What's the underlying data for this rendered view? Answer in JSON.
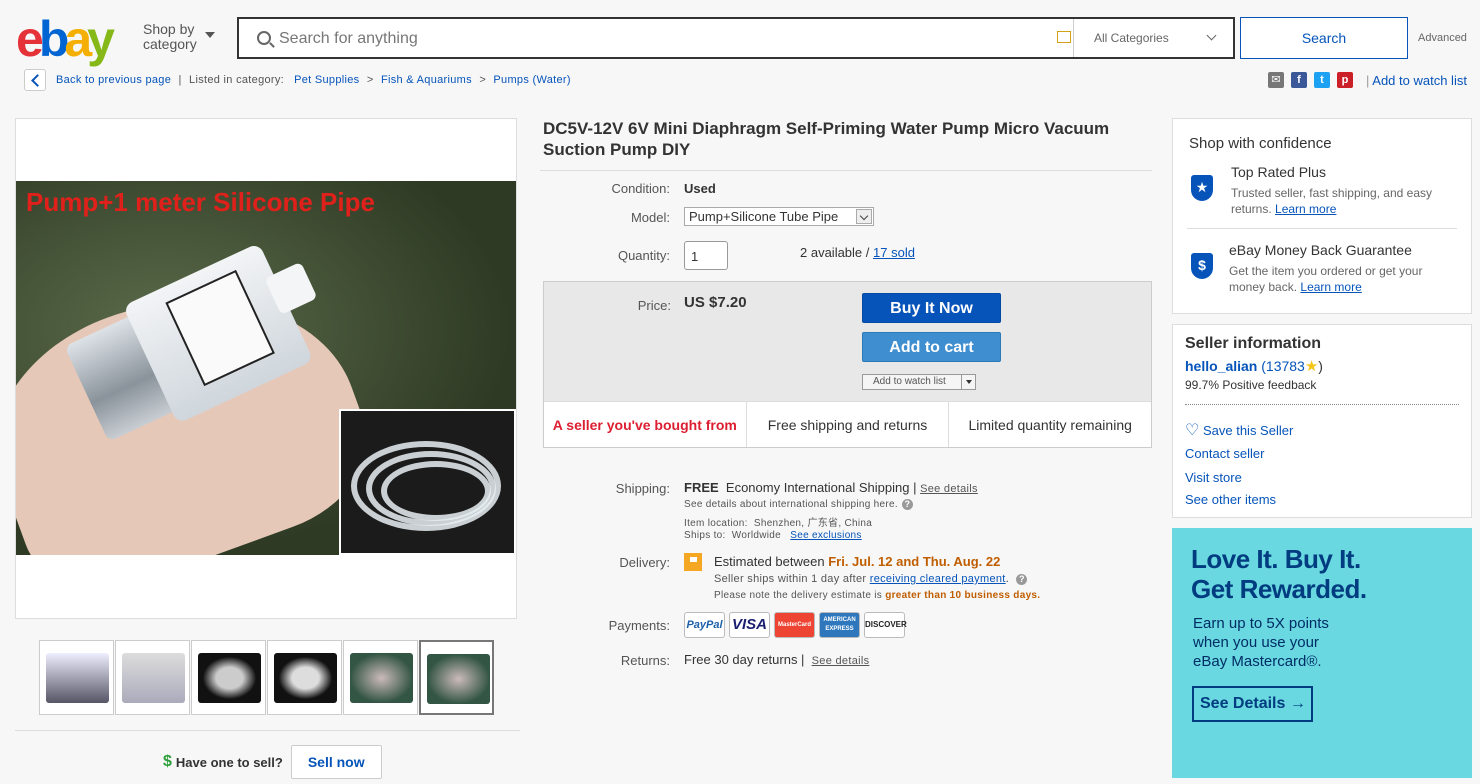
{
  "header": {
    "logo_letters": [
      "e",
      "b",
      "a",
      "y"
    ],
    "logo_colors": [
      "#e53238",
      "#0064d2",
      "#f5af02",
      "#86b817"
    ],
    "shop_by": "Shop by",
    "category": "category",
    "search_placeholder": "Search for anything",
    "category_select": "All Categories",
    "search_button": "Search",
    "advanced": "Advanced"
  },
  "breadcrumb": {
    "back": "Back to previous page",
    "listed_in": "Listed in category:",
    "items": [
      "Pet Supplies",
      "Fish & Aquariums",
      "Pumps (Water)"
    ],
    "add_to_watch": "Add to watch list"
  },
  "gallery": {
    "caption": "Pump+1 meter Silicone Pipe",
    "thumb_count": 6
  },
  "sell": {
    "have_one": "Have one to sell?",
    "sell_now": "Sell now"
  },
  "item": {
    "title": "DC5V-12V 6V Mini Diaphragm Self-Priming Water Pump Micro Vacuum Suction Pump DIY",
    "condition_label": "Condition:",
    "condition": "Used",
    "model_label": "Model:",
    "model": "Pump+Silicone Tube Pipe",
    "quantity_label": "Quantity:",
    "quantity": "1",
    "available": "2 available /",
    "sold": "17 sold",
    "price_label": "Price:",
    "price": "US $7.20",
    "buy_now": "Buy It Now",
    "add_to_cart": "Add to cart",
    "add_to_watch_small": "Add to watch list",
    "highlights": [
      "A seller you've bought from",
      "Free shipping and returns",
      "Limited quantity remaining"
    ]
  },
  "shipping": {
    "label": "Shipping:",
    "free": "FREE",
    "method": "Economy International Shipping |",
    "see_details": "See details",
    "intl_note": "See details about international shipping here.",
    "location_label": "Item location:",
    "location": "Shenzhen, 广东省, China",
    "ships_to_label": "Ships to:",
    "ships_to": "Worldwide",
    "see_exclusions": "See exclusions"
  },
  "delivery": {
    "label": "Delivery:",
    "estimated": "Estimated between",
    "range": "Fri. Jul. 12 and Thu. Aug. 22",
    "seller_ships": "Seller ships within 1 day after",
    "receiving": "receiving cleared payment",
    "note": "Please note the delivery estimate is",
    "note_emph": "greater than 10 business days."
  },
  "payments": {
    "label": "Payments:",
    "methods": [
      "PayPal",
      "VISA",
      "MasterCard",
      "AMERICAN EXPRESS",
      "DISCOVER"
    ]
  },
  "returns": {
    "label": "Returns:",
    "text": "Free 30 day returns |",
    "see_details": "See details"
  },
  "confidence": {
    "heading": "Shop with confidence",
    "trp_title": "Top Rated Plus",
    "trp_text": "Trusted seller, fast shipping, and easy returns.",
    "learn_more": "Learn more",
    "mbg_title": "eBay Money Back Guarantee",
    "mbg_text": "Get the item you ordered or get your money back.",
    "learn_more2": "Learn more"
  },
  "seller": {
    "heading": "Seller information",
    "name": "hello_alian",
    "score": "(13783",
    "close_paren": ")",
    "feedback": "99.7% Positive feedback",
    "save": "Save this Seller",
    "contact": "Contact seller",
    "visit": "Visit store",
    "other": "See other items"
  },
  "promo": {
    "line1": "Love It. Buy It.",
    "line2": "Get Rewarded.",
    "sm1": "Earn up to 5X points",
    "sm2": "when you use your",
    "sm3": "eBay Mastercard®.",
    "button": "See Details →"
  }
}
